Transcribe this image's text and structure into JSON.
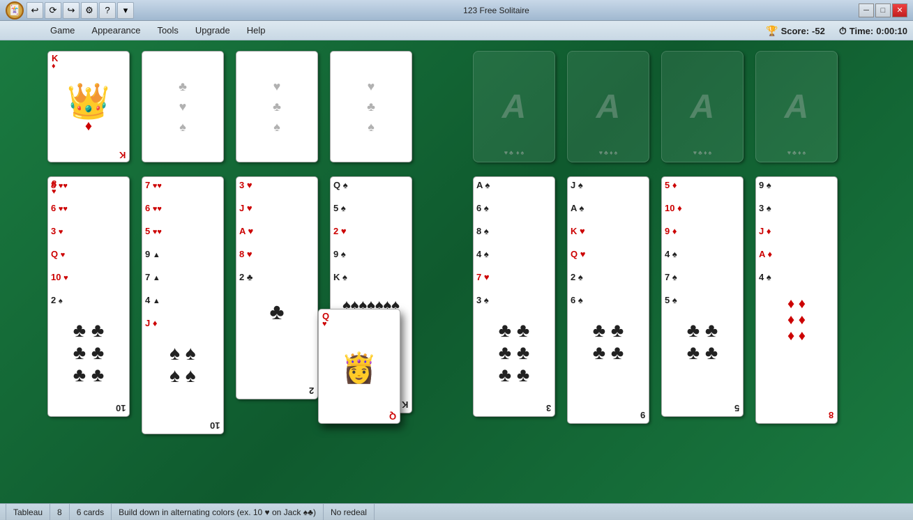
{
  "titlebar": {
    "title": "123 Free Solitaire",
    "buttons": {
      "minimize": "─",
      "maximize": "□",
      "close": "✕"
    }
  },
  "menubar": {
    "items": [
      "Game",
      "Appearance",
      "Tools",
      "Upgrade",
      "Help"
    ]
  },
  "score": {
    "label": "Score:",
    "value": "-52",
    "time_label": "Time:",
    "time_value": "0:00:10"
  },
  "statusbar": {
    "type": "Tableau",
    "columns": "8",
    "cards": "6 cards",
    "rule": "Build down in alternating colors (ex. 10 ♥ on Jack ♠♣)",
    "redeal": "No redeal"
  },
  "game": {
    "background": "#1a7a40"
  }
}
